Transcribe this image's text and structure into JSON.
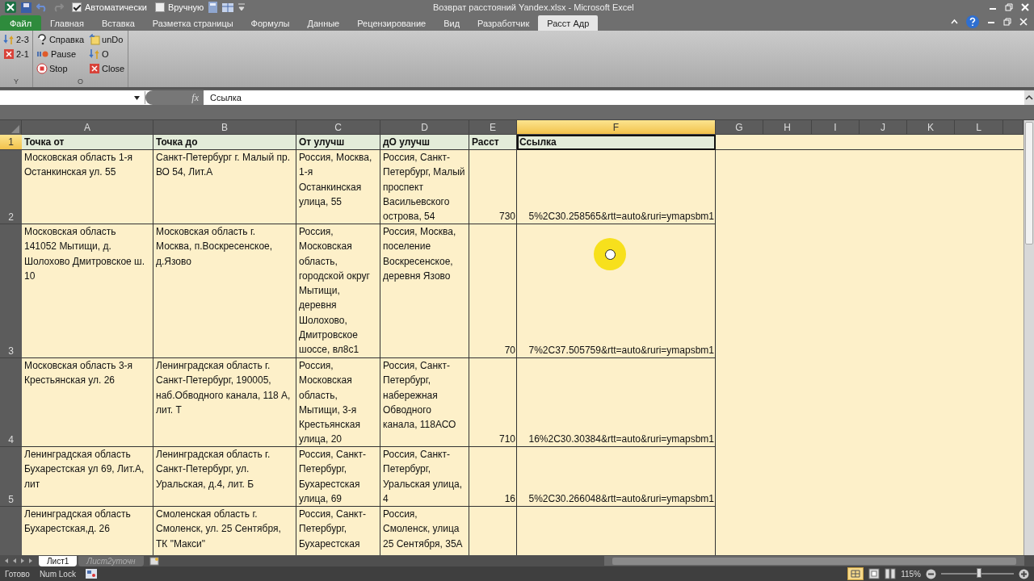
{
  "window": {
    "title": "Возврат расстояний Yandex.xlsx  -  Microsoft Excel"
  },
  "quick_access": [
    {
      "label": "Автоматически",
      "checked": true
    },
    {
      "label": "Вручную",
      "checked": false
    }
  ],
  "tabs": [
    {
      "label": "Файл",
      "kind": "file",
      "selected": false
    },
    {
      "label": "Главная",
      "kind": "tab",
      "selected": false
    },
    {
      "label": "Вставка",
      "kind": "tab",
      "selected": false
    },
    {
      "label": "Разметка страницы",
      "kind": "tab",
      "selected": false
    },
    {
      "label": "Формулы",
      "kind": "tab",
      "selected": false
    },
    {
      "label": "Данные",
      "kind": "tab",
      "selected": false
    },
    {
      "label": "Рецензирование",
      "kind": "tab",
      "selected": false
    },
    {
      "label": "Вид",
      "kind": "tab",
      "selected": false
    },
    {
      "label": "Разработчик",
      "kind": "tab",
      "selected": false
    },
    {
      "label": "Расст Адр",
      "kind": "tab",
      "selected": true
    }
  ],
  "ribbon_groups": [
    {
      "label": "Y",
      "items": [
        {
          "label": "2-3",
          "kind": "swap"
        },
        {
          "label": "2-1",
          "kind": "close"
        }
      ]
    },
    {
      "label": "O",
      "items": [
        {
          "label": "Справка",
          "kind": "help"
        },
        {
          "label": "Pause",
          "kind": "pause"
        },
        {
          "label": "Stop",
          "kind": "stop"
        },
        {
          "label": "unDo",
          "kind": "undo"
        },
        {
          "label": "O",
          "kind": "swap"
        },
        {
          "label": "Close",
          "kind": "close"
        }
      ]
    }
  ],
  "formula_bar": {
    "fx": "fx",
    "value": "Ссылка"
  },
  "columns": [
    {
      "label": "A",
      "selected": false
    },
    {
      "label": "B",
      "selected": false
    },
    {
      "label": "C",
      "selected": false
    },
    {
      "label": "D",
      "selected": false
    },
    {
      "label": "E",
      "selected": false
    },
    {
      "label": "F",
      "selected": true
    },
    {
      "label": "G",
      "selected": false
    },
    {
      "label": "H",
      "selected": false
    },
    {
      "label": "I",
      "selected": false
    },
    {
      "label": "J",
      "selected": false
    },
    {
      "label": "K",
      "selected": false
    },
    {
      "label": "L",
      "selected": false
    }
  ],
  "rows": [
    {
      "number": "1",
      "selected": true,
      "header": true,
      "cells": [
        "Точка от",
        "Точка до",
        "От улучш",
        "дО улучш",
        "Расст",
        "Ссылка"
      ]
    },
    {
      "number": "2",
      "selected": false,
      "header": false,
      "cells": [
        "Московская область 1-я Останкинская ул. 55",
        "Санкт-Петербург г. Малый пр. ВО 54, Лит.А",
        "Россия, Москва, 1-я Останкинская улица, 55",
        "Россия, Санкт-Петербург, Малый проспект Васильевского острова, 54",
        "730",
        "5%2C30.258565&rtt=auto&ruri=ymapsbm1"
      ]
    },
    {
      "number": "3",
      "selected": false,
      "header": false,
      "cells": [
        "Московская область 141052 Мытищи, д. Шолохово Дмитровское ш. 10",
        "Московская область г. Москва, п.Воскресенское, д.Язово",
        "Россия, Московская область, городской округ Мытищи, деревня Шолохово, Дмитровское шоссе, вл8с1",
        "Россия, Москва, поселение Воскресенское, деревня Язово",
        "70",
        "7%2C37.505759&rtt=auto&ruri=ymapsbm1"
      ]
    },
    {
      "number": "4",
      "selected": false,
      "header": false,
      "cells": [
        "Московская область 3-я Крестьянская ул. 26",
        "Ленинградская область г. Санкт-Петербург, 190005, наб.Обводного канала, 118 А, лит. Т",
        "Россия, Московская область, Мытищи, 3-я Крестьянская улица, 20",
        "Россия, Санкт-Петербург, набережная Обводного канала, 118АСО",
        "710",
        "16%2C30.30384&rtt=auto&ruri=ymapsbm1"
      ]
    },
    {
      "number": "5",
      "selected": false,
      "header": false,
      "cells": [
        "Ленинградская область Бухарестская ул 69, Лит.А, лит",
        "Ленинградская область г. Санкт-Петербург, ул. Уральская, д.4, лит. Б",
        "Россия, Санкт-Петербург, Бухарестская улица, 69",
        "Россия, Санкт-Петербург, Уральская улица, 4",
        "16",
        "5%2C30.266048&rtt=auto&ruri=ymapsbm1"
      ]
    },
    {
      "selected": false,
      "header": false,
      "cells": [
        "Ленинградская область Бухарестская,д. 26",
        "Смоленская область г. Смоленск, ул. 25 Сентября, ТК \"Макси\"",
        "Россия, Санкт-Петербург, Бухарестская",
        "Россия, Смоленск, улица 25 Сентября, 35А",
        "",
        ""
      ]
    }
  ],
  "sheets": [
    {
      "label": "Лист1",
      "selected": true
    },
    {
      "label": "Лист2уточн",
      "selected": false
    }
  ],
  "status_bar": {
    "ready": "Готово",
    "num_lock": "Num Lock",
    "zoom": "115%",
    "zoom_slider": {
      "level": 0.52
    }
  }
}
